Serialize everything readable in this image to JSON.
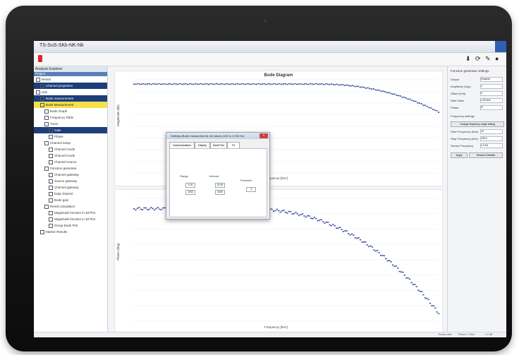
{
  "window": {
    "title": "TS-SuS-SKk-NK-Nk"
  },
  "toolbar": {
    "icons": [
      "download-icon",
      "refresh-icon",
      "edit-icon",
      "eye-icon"
    ]
  },
  "sidebar": {
    "header": "Analysis Explorer",
    "subheader": "Project",
    "nodes": [
      {
        "label": "Result",
        "level": 0,
        "state": "normal"
      },
      {
        "label": "Channel properties",
        "level": 1,
        "state": "dark"
      },
      {
        "label": "Sub",
        "level": 0,
        "state": "normal"
      },
      {
        "label": "Bode measurement",
        "level": 1,
        "state": "dark"
      },
      {
        "label": "Bode Measurement",
        "level": 1,
        "state": "yellow"
      },
      {
        "label": "Bode Graph",
        "level": 2,
        "state": "normal"
      },
      {
        "label": "Frequency Table",
        "level": 2,
        "state": "normal"
      },
      {
        "label": "Trace",
        "level": 2,
        "state": "normal"
      },
      {
        "label": "Gain",
        "level": 3,
        "state": "dark"
      },
      {
        "label": "Phase",
        "level": 3,
        "state": "normal"
      },
      {
        "label": "Channel setup",
        "level": 2,
        "state": "normal"
      },
      {
        "label": "Channel mode",
        "level": 3,
        "state": "normal"
      },
      {
        "label": "Channel mode",
        "level": 3,
        "state": "normal"
      },
      {
        "label": "Channel source",
        "level": 3,
        "state": "normal"
      },
      {
        "label": "Function generator",
        "level": 2,
        "state": "normal"
      },
      {
        "label": "Channel gateway",
        "level": 3,
        "state": "normal"
      },
      {
        "label": "Source gateway",
        "level": 3,
        "state": "normal"
      },
      {
        "label": "Channel gateway",
        "level": 3,
        "state": "normal"
      },
      {
        "label": "Data channel",
        "level": 3,
        "state": "normal"
      },
      {
        "label": "Bode gain",
        "level": 3,
        "state": "normal"
      },
      {
        "label": "Result calculation",
        "level": 2,
        "state": "normal"
      },
      {
        "label": "Magnitude function in 3d Plot",
        "level": 3,
        "state": "normal"
      },
      {
        "label": "Magnitude function in 3d Plot",
        "level": 3,
        "state": "normal"
      },
      {
        "label": "Group Bode Plot",
        "level": 3,
        "state": "normal"
      },
      {
        "label": "Marker Results",
        "level": 1,
        "state": "normal"
      }
    ]
  },
  "plots": {
    "top": {
      "title": "Bode Diagram",
      "ylabel": "Magnitude (dB)",
      "xlabel": "Frequency [kHz]"
    },
    "bottom": {
      "title": "",
      "ylabel": "Phase (deg)",
      "xlabel": "Frequency [kHz]"
    }
  },
  "right_panel": {
    "title": "Function generator settings",
    "rows": [
      {
        "label": "Output",
        "value": "Channel"
      },
      {
        "label": "Amplitude (Vpp)",
        "value": "1"
      },
      {
        "label": "Offset (Volt)",
        "value": "0"
      },
      {
        "label": "Start Value",
        "value": "1.00 kHz"
      },
      {
        "label": "Phase",
        "value": "0°"
      }
    ],
    "section": "Frequency settings",
    "dropdown": "Change frequency range setting",
    "freq_rows": [
      {
        "label": "Start Frequency (kHz)",
        "value": "10"
      },
      {
        "label": "Stop Frequency (kHz)",
        "value": "100 k"
      },
      {
        "label": "Sweep Frequency",
        "value": "1.0 Hz"
      }
    ],
    "buttons": [
      "Apply",
      "Restore Defaults"
    ]
  },
  "dialog": {
    "title": "Settings (Bode measurement): All values (100 to 1 000 Hz)",
    "tabs": [
      "Communications",
      "Display",
      "Bode Plot",
      "Fit"
    ],
    "groups": [
      {
        "label": "Range",
        "spins": [
          "1.00",
          "1000"
        ]
      },
      {
        "label": "Interval",
        "spins": [
          "10.00",
          "1000"
        ]
      },
      {
        "label": "Precision",
        "spins": [
          "3"
        ]
      }
    ]
  },
  "statusbar": {
    "left": "Ready state",
    "mid": "Phase 1 / Sine",
    "right": "1.0 dB"
  }
}
